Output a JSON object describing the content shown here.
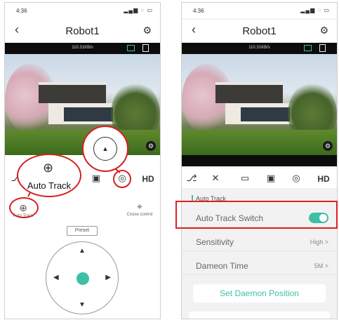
{
  "status": {
    "time": "4:36",
    "icons": "▂▄▆ ◌ ▭"
  },
  "nav": {
    "title": "Robot1",
    "back_icon": "‹",
    "gear_icon": "⚙"
  },
  "stream": {
    "rate": "110.31KB/s"
  },
  "toolbar": {
    "hd": "HD",
    "mic": "⎇",
    "mute": "✕",
    "record": "▭",
    "snapshot": "▣",
    "ptz": "◎"
  },
  "functions": {
    "auto_track": "Auto Track",
    "cruise": "Cruise control",
    "auto_track_icon": "⊕",
    "cruise_icon": "⌖"
  },
  "preset": {
    "label": "Preset"
  },
  "dpad": {
    "up": "▲",
    "down": "▼",
    "left": "◀",
    "right": "▶"
  },
  "callouts": {
    "auto_track_label": "Auto Track"
  },
  "settings": {
    "section": "Auto Track",
    "switch_label": "Auto Track Switch",
    "switch_on": true,
    "sensitivity_label": "Sensitivity",
    "sensitivity_value": "High >",
    "daemon_time_label": "Dameon Time",
    "daemon_time_value": "5M >",
    "set_daemon_button": "Set Daemon Position"
  },
  "colors": {
    "accent": "#3ebfa6",
    "callout": "#d61f1f"
  }
}
